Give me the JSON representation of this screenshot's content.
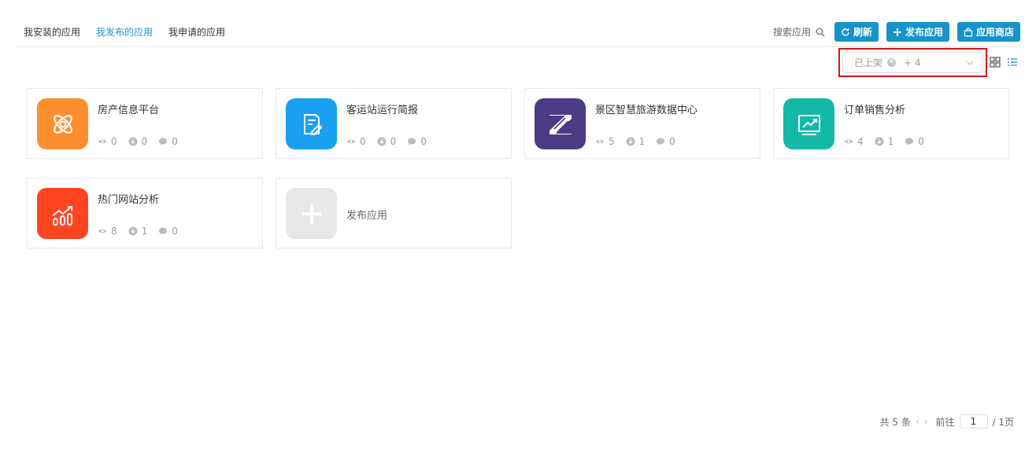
{
  "tabs": [
    {
      "label": "我安装的应用",
      "active": false
    },
    {
      "label": "我发布的应用",
      "active": true
    },
    {
      "label": "我申请的应用",
      "active": false
    }
  ],
  "toolbar": {
    "search_label": "搜索应用",
    "refresh_label": "刷新",
    "publish_label": "发布应用",
    "store_label": "应用商店"
  },
  "filter": {
    "selected_tag": "已上架",
    "more_count": "+ 4"
  },
  "apps": [
    {
      "name": "房产信息平台",
      "icon": "atom-icon",
      "color": "#ff8f2e",
      "views": "0",
      "downloads": "0",
      "comments": "0"
    },
    {
      "name": "客运站运行简报",
      "icon": "document-edit-icon",
      "color": "#19a0f0",
      "views": "0",
      "downloads": "0",
      "comments": "0"
    },
    {
      "name": "景区智慧旅游数据中心",
      "icon": "z-logo-icon",
      "color": "#4b3a84",
      "views": "5",
      "downloads": "1",
      "comments": "0"
    },
    {
      "name": "订单销售分析",
      "icon": "chart-trend-icon",
      "color": "#14b8a6",
      "views": "4",
      "downloads": "1",
      "comments": "0"
    },
    {
      "name": "热门网站分析",
      "icon": "bar-trend-icon",
      "color": "#ff4422",
      "views": "8",
      "downloads": "1",
      "comments": "0"
    }
  ],
  "add_card": {
    "label": "发布应用"
  },
  "pagination": {
    "total": "共 5 条",
    "goto_label": "前往",
    "page": "1",
    "pages": "/ 1页"
  },
  "colors": {
    "accent": "#1694c9",
    "highlight_border": "#d9121b"
  }
}
